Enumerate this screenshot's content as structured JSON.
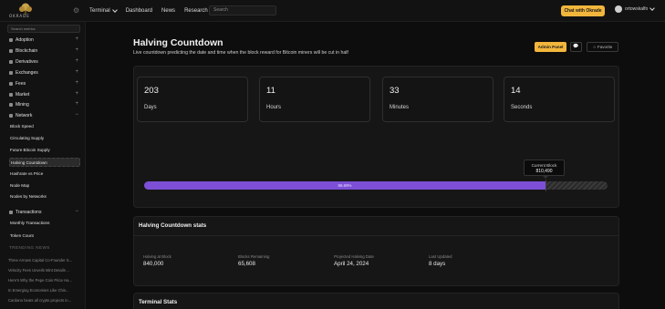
{
  "brand": {
    "logo_text": "OKRADE"
  },
  "topnav": {
    "items": [
      {
        "label": "Terminal",
        "dropdown": true
      },
      {
        "label": "Dashboard",
        "dropdown": false
      },
      {
        "label": "News",
        "dropdown": false
      },
      {
        "label": "Research",
        "dropdown": false
      }
    ],
    "search_placeholder": "Search",
    "chat_label": "Chat with Okrade",
    "username": "ortowskalfo"
  },
  "sidebar": {
    "search_placeholder": "Search metrics",
    "sections": [
      {
        "label": "Adoption",
        "toggle": "+"
      },
      {
        "label": "Blockchain",
        "toggle": "+"
      },
      {
        "label": "Derivatives",
        "toggle": "+"
      },
      {
        "label": "Exchanges",
        "toggle": "+"
      },
      {
        "label": "Fees",
        "toggle": "+"
      },
      {
        "label": "Market",
        "toggle": "+"
      },
      {
        "label": "Mining",
        "toggle": "+"
      },
      {
        "label": "Network",
        "toggle": "−"
      }
    ],
    "network_items": [
      "Block Speed",
      "Circulating Supply",
      "Future Bitcoin Supply",
      "Halving Countdown",
      "Hashrate vs Price",
      "Node Map",
      "Nodes by Networks"
    ],
    "transactions": {
      "label": "Transactions",
      "toggle": "−"
    },
    "transaction_items": [
      "Monthly Transactions",
      "Token Count"
    ],
    "trending_header": "TRENDING NEWS",
    "trending": [
      "Three Arrows Capital Co-Founder S...",
      "Velocity Fees Unveils Mint Details ...",
      "Here's Why the Pepe Coin Price Ha...",
      "In Emerging Economies Like Chin...",
      "Cardano beats all crypto projects in..."
    ]
  },
  "page": {
    "title": "Halving Countdown",
    "subtitle": "Live countdown predicting the date and time when the block reward for Bitcoin miners will be cut in half",
    "admin_label": "Admin Panel",
    "message_icon": "💬",
    "favorite_label": "☆ Favorite"
  },
  "countdown": [
    {
      "value": "203",
      "unit": "Days"
    },
    {
      "value": "11",
      "unit": "Hours"
    },
    {
      "value": "33",
      "unit": "Minutes"
    },
    {
      "value": "14",
      "unit": "Seconds"
    }
  ],
  "progress": {
    "percent_label": "86.69%",
    "fraction": 0.8669,
    "tooltip_title": "Current Block",
    "tooltip_value": "810,490",
    "fill_color": "#7c4fd6"
  },
  "stats": {
    "title": "Halving Countdown stats",
    "items": [
      {
        "label": "Halving at Block",
        "value": "840,000"
      },
      {
        "label": "Blocks Remaining",
        "value": "65,608"
      },
      {
        "label": "Projected Halving Date",
        "value": "April 24, 2024"
      },
      {
        "label": "Last Updated",
        "value": "8 days"
      }
    ]
  },
  "terminal": {
    "title": "Terminal Stats"
  },
  "colors": {
    "accent": "#f2b63c",
    "progress": "#7c4fd6",
    "background": "#0d0d0d"
  }
}
